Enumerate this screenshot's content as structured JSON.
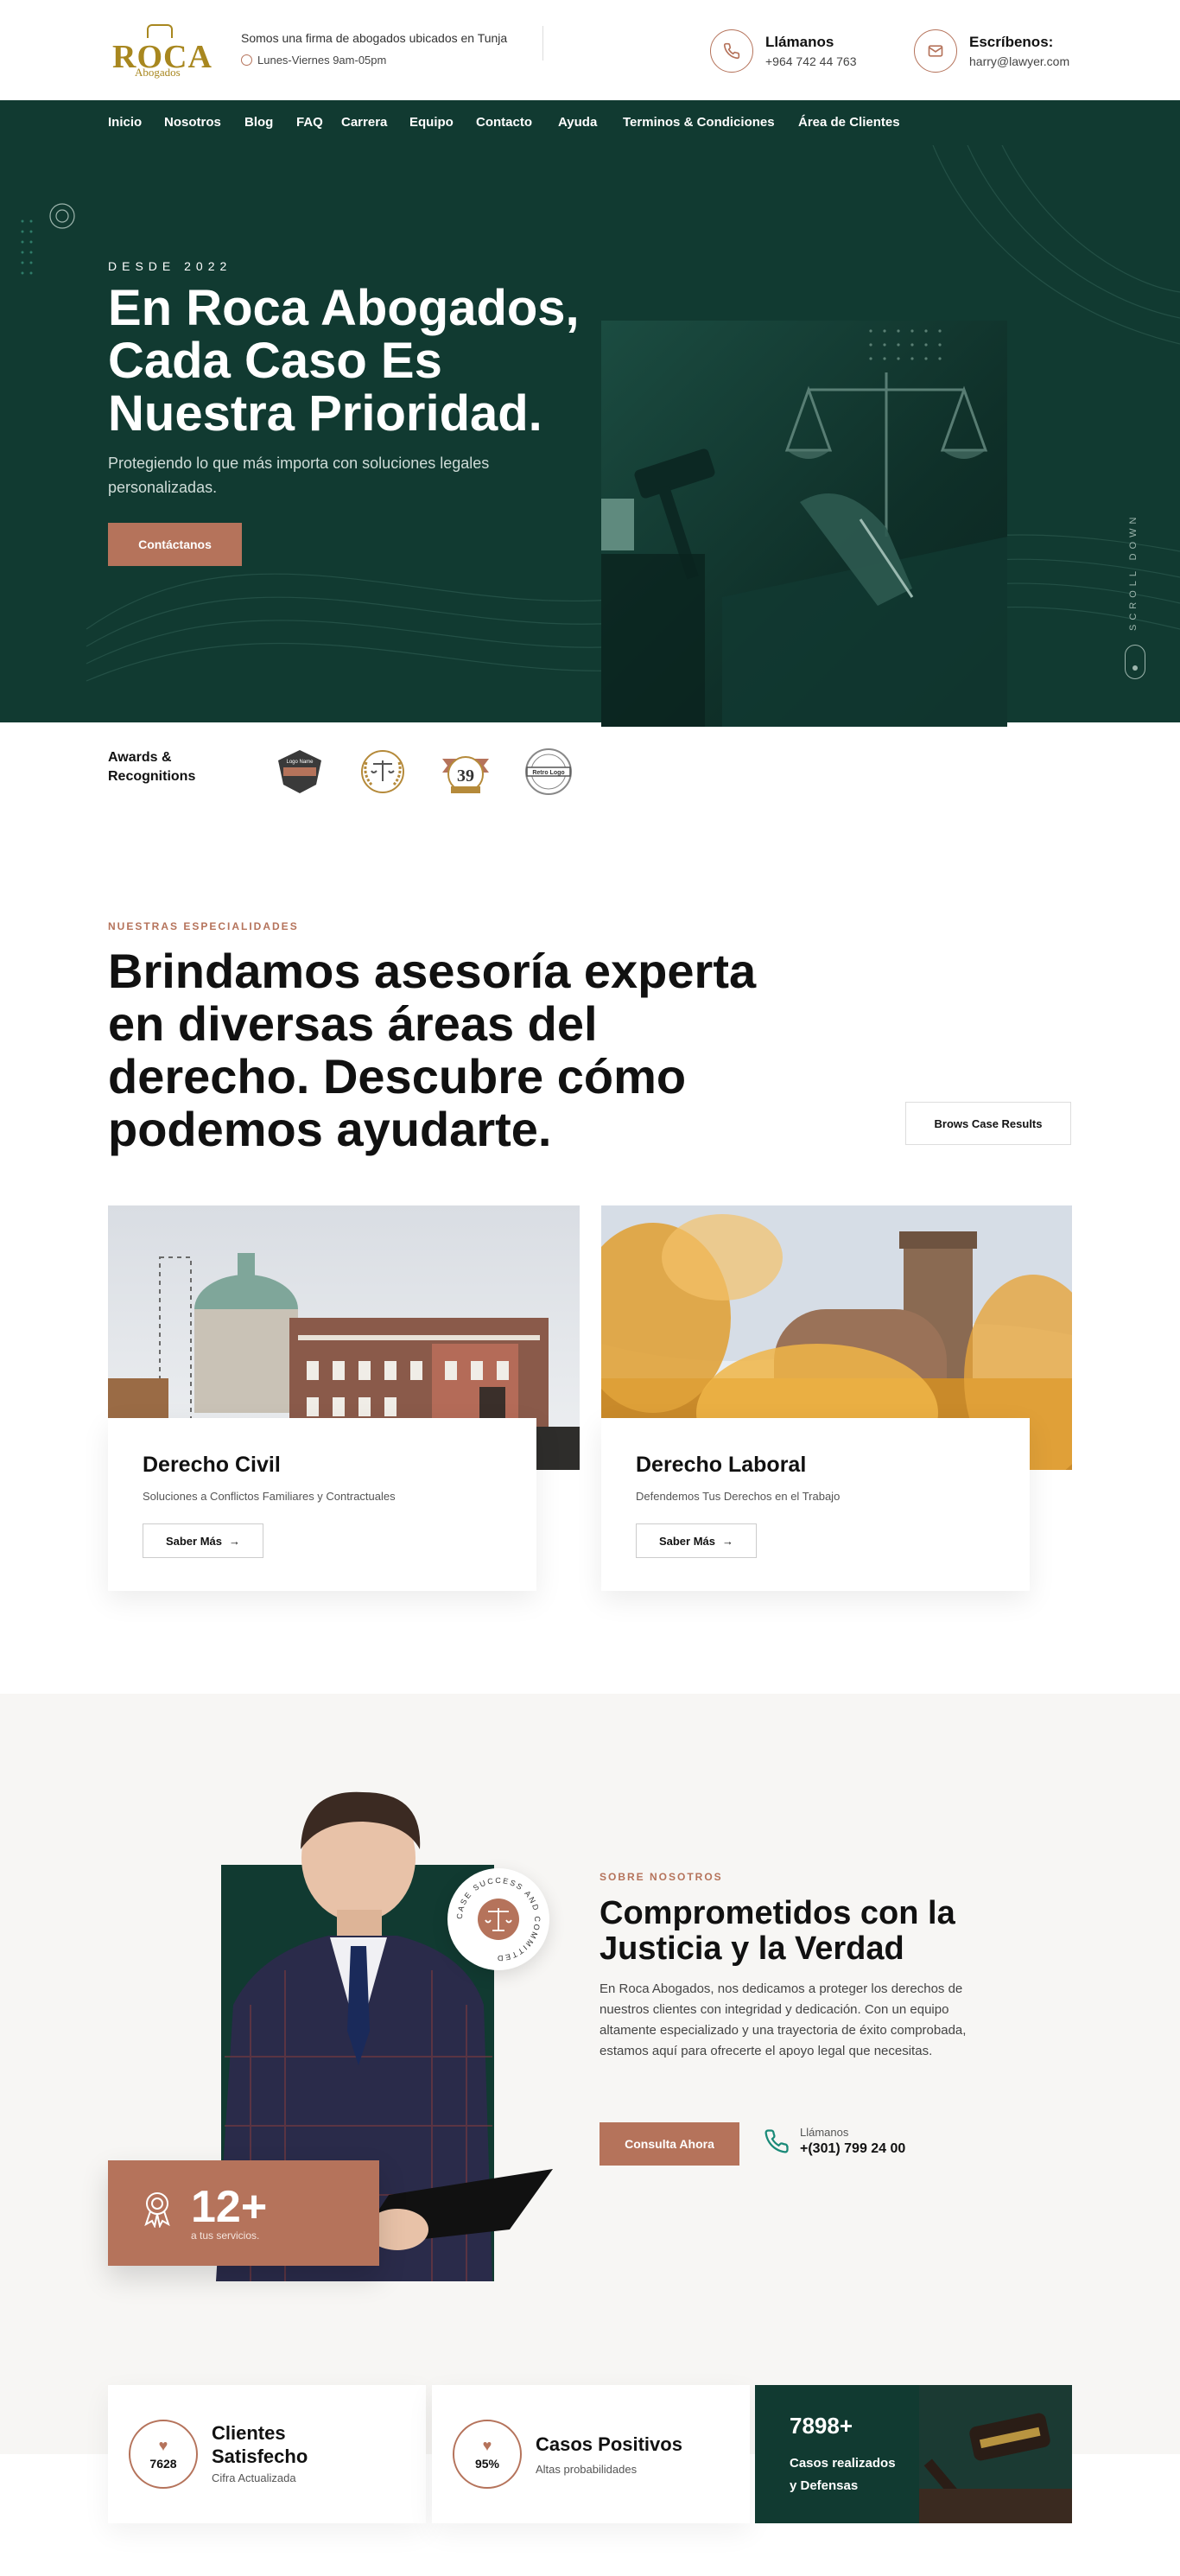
{
  "brand": {
    "name": "ROCA",
    "sub": "Abogados",
    "color": "#a8871f"
  },
  "topbar": {
    "tagline": "Somos una firma de abogados ubicados en Tunja",
    "hours": "Lunes-Viernes 9am-05pm",
    "call": {
      "title": "Llámanos",
      "value": "+964 742 44 763",
      "icon": "phone-icon"
    },
    "mail": {
      "title": "Escríbenos:",
      "value": "harry@lawyer.com",
      "icon": "mail-icon"
    }
  },
  "nav": {
    "items": [
      "Inicio",
      "Nosotros",
      "Blog",
      "FAQ",
      "Carrera",
      "Equipo",
      "Contacto",
      "Ayuda",
      "Terminos & Condiciones",
      "Área de Clientes"
    ]
  },
  "hero": {
    "since": "DESDE 2022",
    "title": "En Roca Abogados, Cada Caso Es Nuestra Prioridad.",
    "subtitle": "Protegiendo lo que más importa con soluciones legales personalizadas.",
    "cta": "Contáctanos",
    "scroll": "SCROLL DOWN"
  },
  "awards": {
    "label": "Awards & Recognitions",
    "badges": [
      "Logo Name",
      "Justice",
      "39",
      "Retro Logo"
    ]
  },
  "specialties": {
    "eyebrow": "NUESTRAS ESPECIALIDADES",
    "title": "Brindamos asesoría experta en diversas áreas del derecho. Descubre cómo podemos ayudarte.",
    "button": "Brows Case Results",
    "cards": [
      {
        "title": "Derecho Civil",
        "subtitle": "Soluciones a Conflictos Familiares y Contractuales",
        "cta": "Saber Más"
      },
      {
        "title": "Derecho Laboral",
        "subtitle": "Defendemos Tus Derechos en el Trabajo",
        "cta": "Saber Más"
      }
    ]
  },
  "about": {
    "eyebrow": "SOBRE NOSOTROS",
    "title": "Comprometidos con la Justicia y la Verdad",
    "text": "En Roca Abogados, nos dedicamos a proteger los derechos de nuestros clientes con integridad y dedicación. Con un equipo altamente especializado y una trayectoria de éxito comprobada, estamos aquí para ofrecerte el apoyo legal que necesitas.",
    "cta": "Consulta Ahora",
    "call_label": "Llámanos",
    "call_value": "+(301) 799 24 00",
    "badge_text": "CASE SUCCESS AND COMMITTED",
    "experience": {
      "value": "12+",
      "label": "a tus servicios."
    }
  },
  "stats": [
    {
      "num": "7628",
      "title": "Clientes Satisfecho",
      "sub": "Cifra Actualizada"
    },
    {
      "num": "95%",
      "title": "Casos Positivos",
      "sub": "Altas probabilidades"
    },
    {
      "num": "7898+",
      "title": "Casos realizados y Defensas"
    }
  ],
  "colors": {
    "green": "#113a31",
    "accent": "#b5735b"
  }
}
